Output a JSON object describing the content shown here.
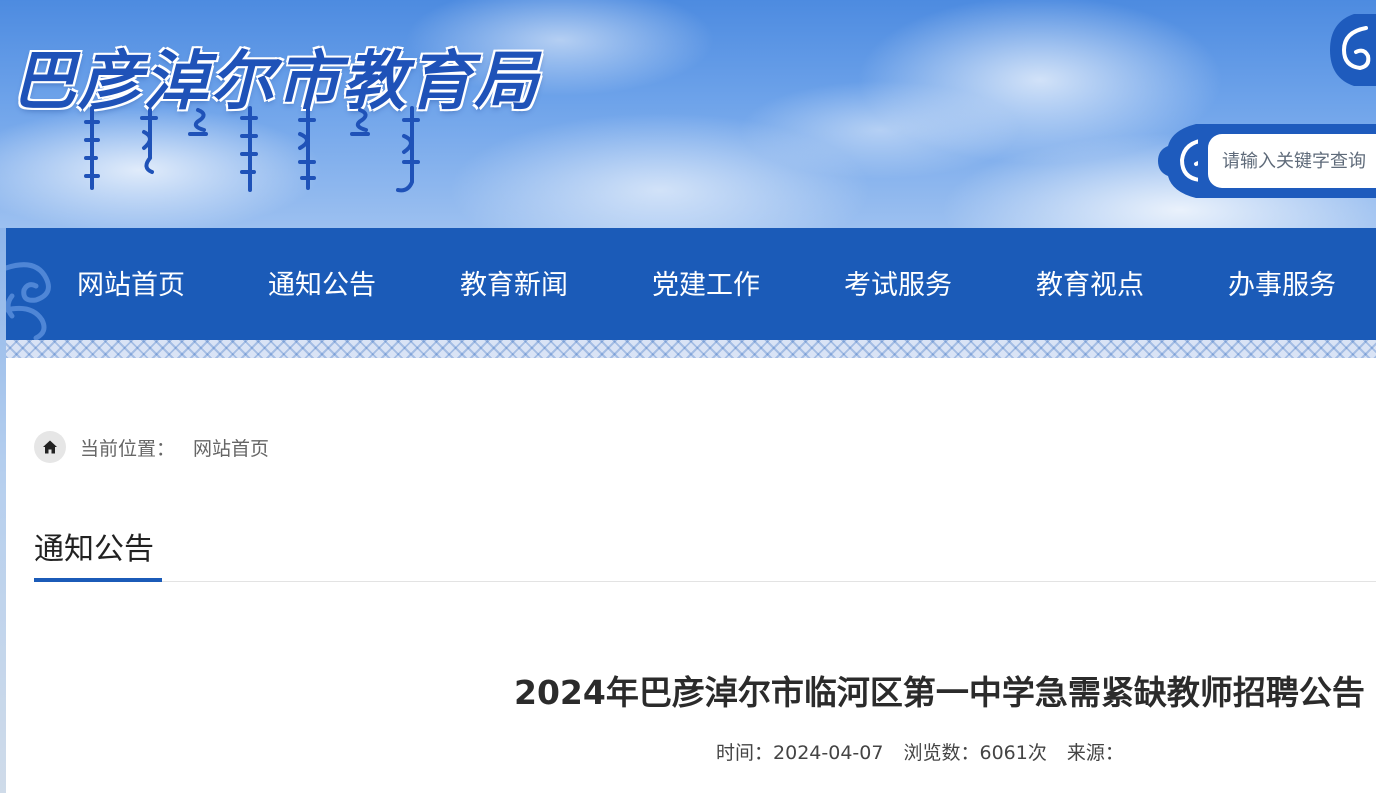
{
  "header": {
    "site_title": "巴彦淖尔市教育局",
    "search_placeholder": "请输入关键字查询"
  },
  "nav": {
    "items": [
      {
        "label": "网站首页"
      },
      {
        "label": "通知公告"
      },
      {
        "label": "教育新闻"
      },
      {
        "label": "党建工作"
      },
      {
        "label": "考试服务"
      },
      {
        "label": "教育视点"
      },
      {
        "label": "办事服务"
      }
    ]
  },
  "breadcrumb": {
    "label": "当前位置：",
    "items": [
      "网站首页"
    ]
  },
  "section": {
    "title": "通知公告"
  },
  "article": {
    "title": "2024年巴彦淖尔市临河区第一中学急需紧缺教师招聘公告",
    "time_label": "时间：",
    "time_value": "2024-04-07",
    "views_label": "浏览数：",
    "views_value": "6061次",
    "source_label": "来源："
  },
  "colors": {
    "nav_blue": "#1b5bb8",
    "title_blue": "#1f52b8"
  },
  "icons": {
    "home": "home-icon",
    "search_decoration": "cloud-scroll-icon",
    "nav_decoration": "cloud-scroll-icon"
  }
}
